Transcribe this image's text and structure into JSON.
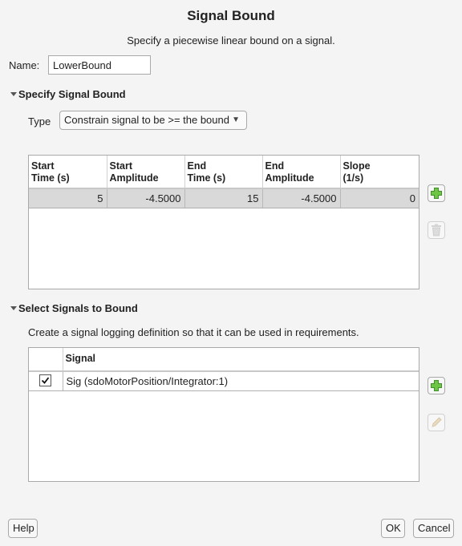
{
  "dialog": {
    "title": "Signal Bound",
    "subtitle": "Specify a piecewise linear bound on a signal."
  },
  "name_field": {
    "label": "Name:",
    "value": "LowerBound"
  },
  "specify_section": {
    "heading": "Specify Signal Bound",
    "expanded": true,
    "type_label": "Type",
    "type_selected": "Constrain signal to be >= the bound",
    "table": {
      "columns": [
        {
          "line1": "Start",
          "line2": "Time (s)"
        },
        {
          "line1": "Start",
          "line2": "Amplitude"
        },
        {
          "line1": "End",
          "line2": "Time (s)"
        },
        {
          "line1": "End",
          "line2": "Amplitude"
        },
        {
          "line1": "Slope",
          "line2": "(1/s)"
        }
      ],
      "rows": [
        [
          "5",
          "-4.5000",
          "15",
          "-4.5000",
          "0"
        ]
      ]
    },
    "add_icon": "plus-icon",
    "delete_icon": "trash-icon"
  },
  "select_section": {
    "heading": "Select Signals to Bound",
    "expanded": true,
    "description": "Create a signal logging definition so that it can be used in requirements.",
    "table": {
      "columns": [
        "",
        "Signal"
      ],
      "rows": [
        {
          "checked": true,
          "signal": "Sig (sdoMotorPosition/Integrator:1)"
        }
      ]
    },
    "add_icon": "plus-icon",
    "edit_icon": "pencil-icon"
  },
  "footer": {
    "help": "Help",
    "ok": "OK",
    "cancel": "Cancel"
  },
  "colors": {
    "background": "#f4f4f4",
    "selected_row": "#d9d9d9",
    "plus_green": "#5cb85c"
  }
}
